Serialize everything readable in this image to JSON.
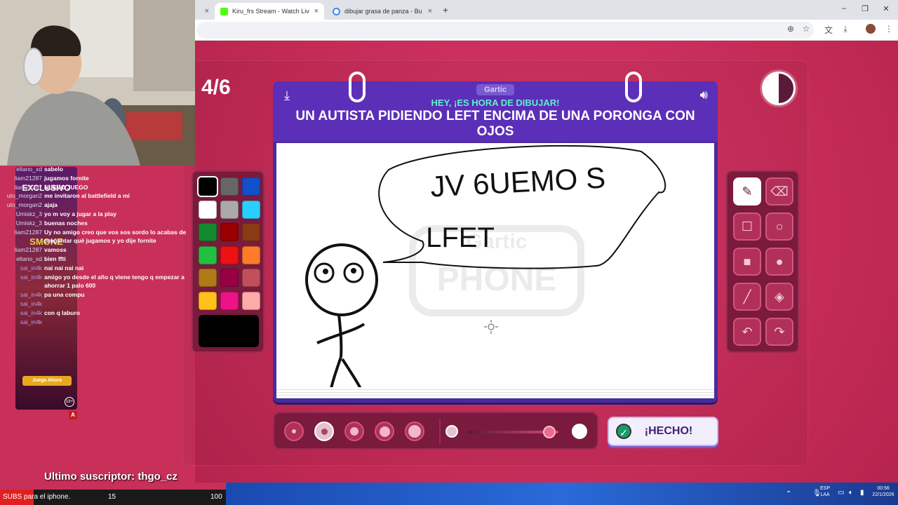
{
  "browser": {
    "tabs": [
      {
        "label": "Kiru_frs Stream - Watch Live on",
        "favicon_color": "#53fc18"
      },
      {
        "label": "dibujar grasa de panza - Buscar",
        "favicon_color": "#4285f4"
      }
    ],
    "new_tab": "+",
    "close": "×",
    "window_controls": [
      "–",
      "❐",
      "✕"
    ],
    "toolbar_icons": [
      "zoom-icon",
      "star-icon",
      "translate-icon",
      "download-icon",
      "profile-icon",
      "menu-icon"
    ]
  },
  "game": {
    "round": "4/6",
    "timer_fraction_remaining": 0.5,
    "logo": "Gartic",
    "subtitle": "HEY, ¡ES HORA DE DIBUJAR!",
    "prompt": "UN AUTISTA PIDIENDO LEFT ENCIMA DE UNA PORONGA CON OJOS",
    "watermark": "Gartic PHONE",
    "drawing_text": [
      "JV 6UEMO S",
      "LFET"
    ],
    "palette": [
      "#000000",
      "#666666",
      "#1150c8",
      "#ffffff",
      "#aaaaaa",
      "#29d0ff",
      "#138a2e",
      "#990000",
      "#8a3a14",
      "#22c040",
      "#ee1111",
      "#ff7a2a",
      "#b07a18",
      "#990044",
      "#c24e5c",
      "#ffc018",
      "#ee1188",
      "#ffaaaa"
    ],
    "selected_color": "#000000",
    "tools": [
      {
        "name": "pencil-tool",
        "glyph": "✎",
        "selected": true
      },
      {
        "name": "eraser-tool",
        "glyph": "⌫",
        "selected": false
      },
      {
        "name": "rectangle-outline-tool",
        "glyph": "☐",
        "selected": false
      },
      {
        "name": "ellipse-outline-tool",
        "glyph": "○",
        "selected": false
      },
      {
        "name": "rectangle-fill-tool",
        "glyph": "■",
        "selected": false
      },
      {
        "name": "ellipse-fill-tool",
        "glyph": "●",
        "selected": false
      },
      {
        "name": "line-tool",
        "glyph": "╱",
        "selected": false
      },
      {
        "name": "fill-bucket-tool",
        "glyph": "◈",
        "selected": false
      },
      {
        "name": "undo-tool",
        "glyph": "↶",
        "selected": false
      },
      {
        "name": "redo-tool",
        "glyph": "↷",
        "selected": false
      }
    ],
    "brush_sizes": [
      1,
      2,
      3,
      4,
      5
    ],
    "selected_brush_size": 2,
    "opacity_fraction": 0.9,
    "done_label": "¡HECHO!"
  },
  "stream": {
    "chat": [
      {
        "user": "eltano_xd",
        "msg": "sabelo",
        "badge": false
      },
      {
        "user": "liam21287",
        "msg": "jugamos fornite",
        "badge": false
      },
      {
        "user": "liam21287",
        "msg": "NUEVO JUEGO",
        "badge": false
      },
      {
        "user": "uto_morgan2",
        "msg": "me invitaron al battlefield a mi",
        "badge": false
      },
      {
        "user": "uto_morgan2",
        "msg": "ajaja",
        "badge": false
      },
      {
        "user": "Umiskz_3",
        "msg": "yo m voy a jugar a la play",
        "badge": false
      },
      {
        "user": "Umiskz_3",
        "msg": "buenas noches",
        "badge": false
      },
      {
        "user": "liam21287",
        "msg": "Uy no amigo creo que vos sos sordo lo acabas de",
        "badge": false
      },
      {
        "user": "",
        "msg": "preguntar qué jugamos y yo dije fornite",
        "badge": false
      },
      {
        "user": "liam21287",
        "msg": "vamoss",
        "badge": false
      },
      {
        "user": "eltano_xd",
        "msg": "bien ffti",
        "badge": false
      },
      {
        "user": "sai_in4k",
        "msg": "nai nai nai nai",
        "badge": true
      },
      {
        "user": "sai_in4k",
        "msg": "amigo yo desde el año q viene tengo q empezar a",
        "badge": true
      },
      {
        "user": "",
        "msg": "ahorrar 1 palo 600",
        "badge": false
      },
      {
        "user": "sai_in4k",
        "msg": "pa una compu",
        "badge": true
      },
      {
        "user": "sai_in4k",
        "msg": "",
        "badge": true
      },
      {
        "user": "sai_in4k",
        "msg": "con q laburo",
        "badge": true
      },
      {
        "user": "sai_in4k",
        "msg": "",
        "badge": true
      }
    ],
    "ad": {
      "title": "EXCLUSIVO",
      "brand": "SMOKE",
      "cta": "Juega Ahora",
      "age": "18+",
      "mark": "A"
    },
    "last_sub_label": "Ultimo suscriptor: thgo_cz",
    "subs_goal": {
      "text": "SUBS para el iphone.",
      "current": "15",
      "target": "100"
    }
  },
  "taskbar": {
    "lang": "ESP\nLAA",
    "time": "00:56",
    "date": "22/1/2026"
  }
}
